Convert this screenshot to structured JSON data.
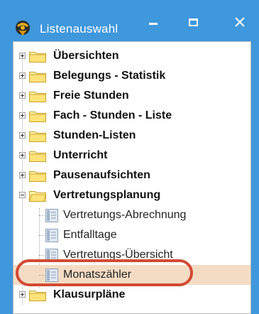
{
  "window": {
    "title": "Listenauswahl",
    "icon": "app-list-icon",
    "title_color": "#3f97dc"
  },
  "tree": {
    "folders_top": [
      {
        "label": "Übersichten",
        "expanded": false
      },
      {
        "label": "Belegungs - Statistik",
        "expanded": false
      },
      {
        "label": "Freie Stunden",
        "expanded": false
      },
      {
        "label": "Fach - Stunden - Liste",
        "expanded": false
      },
      {
        "label": "Stunden-Listen",
        "expanded": false
      },
      {
        "label": "Unterricht",
        "expanded": false
      },
      {
        "label": "Pausenaufsichten",
        "expanded": false
      }
    ],
    "expanded_folder": {
      "label": "Vertretungsplanung",
      "expanded": true
    },
    "children": [
      {
        "label": "Vertretungs-Abrechnung"
      },
      {
        "label": "Entfalltage"
      },
      {
        "label": "Vertretungs-Übersicht"
      },
      {
        "label": "Monatszähler",
        "selected": true
      }
    ],
    "folders_bottom": [
      {
        "label": "Klausurpläne",
        "expanded": false
      }
    ]
  },
  "colors": {
    "selection": "#f4dcc4",
    "highlight_ring": "#d24a34"
  }
}
